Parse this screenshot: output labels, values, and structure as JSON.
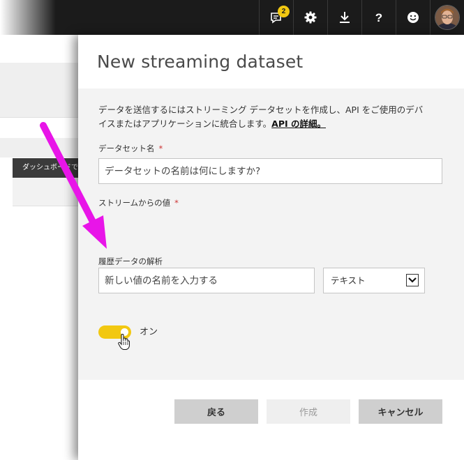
{
  "topbar": {
    "notification_count": "2",
    "icons": [
      "notifications-icon",
      "gear-icon",
      "download-icon",
      "help-icon",
      "smiley-icon",
      "avatar"
    ]
  },
  "background": {
    "table_header": "ダッシュボードで使用"
  },
  "panel": {
    "title": "New streaming dataset",
    "description": "データを送信するにはストリーミング データセットを作成し、API をご使用のデバイスまたはアプリケーションに統合します。",
    "learn_more": "API の詳細。",
    "dataset_name_label": "データセット名",
    "dataset_name_placeholder": "データセットの名前は何にしますか?",
    "stream_values_label": "ストリームからの値",
    "value_name_placeholder": "新しい値の名前を入力する",
    "value_type": "テキスト",
    "historic_label": "履歴データの解析",
    "historic_state": "オン",
    "historic_on": true,
    "required_mark": "*"
  },
  "buttons": {
    "back": "戻る",
    "create": "作成",
    "cancel": "キャンセル"
  },
  "colors": {
    "accent": "#f2c811",
    "arrow": "#e815e8",
    "topbar": "#1b1b1b"
  }
}
